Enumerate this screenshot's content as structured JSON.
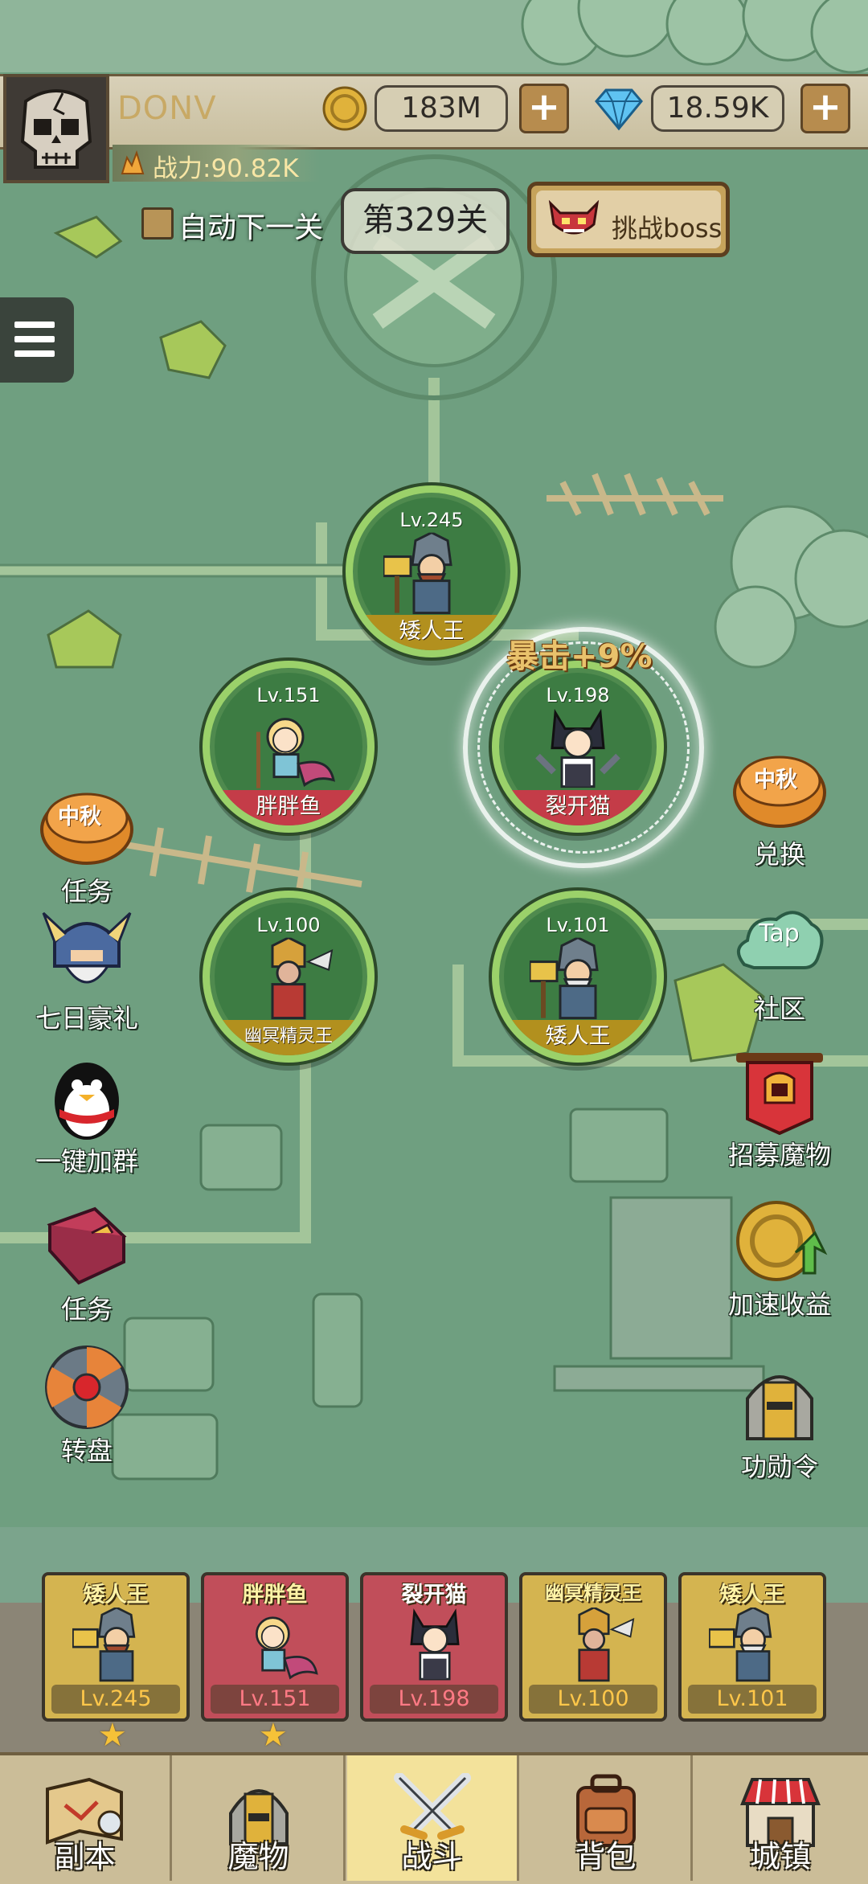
{
  "player": {
    "name": "DONV",
    "power": "战力:90.82K"
  },
  "currency": {
    "gold": "183M",
    "gems": "18.59K",
    "plus": "+"
  },
  "stage": {
    "auto_next_label": "自动下一关",
    "stage_label": "第329关",
    "boss_button_label": "挑战boss"
  },
  "battle_units": [
    {
      "level": "Lv.245",
      "name": "矮人王",
      "style": "gold"
    },
    {
      "level": "Lv.151",
      "name": "胖胖鱼",
      "style": "red"
    },
    {
      "level": "Lv.198",
      "name": "裂开猫",
      "style": "red"
    },
    {
      "level": "Lv.100",
      "name": "幽冥精灵王",
      "style": "gold"
    },
    {
      "level": "Lv.101",
      "name": "矮人王",
      "style": "gold"
    }
  ],
  "crit_buff": "暴击+9%",
  "left_icons": {
    "task_event": "任务",
    "seven_day": "七日豪礼",
    "join_group": "一键加群",
    "tasks": "任务",
    "wheel": "转盘",
    "moon_badge": "中秋"
  },
  "right_icons": {
    "exchange": "兑换",
    "community": "社区",
    "community_badge": "Tap",
    "recruit": "招募魔物",
    "speed_income": "加速收益",
    "merit_pass": "功勋令",
    "moon_badge": "中秋"
  },
  "team": [
    {
      "name": "矮人王",
      "level": "Lv.245",
      "style": "gold",
      "starred": true
    },
    {
      "name": "胖胖鱼",
      "level": "Lv.151",
      "style": "red",
      "starred": true
    },
    {
      "name": "裂开猫",
      "level": "Lv.198",
      "style": "red",
      "starred": false
    },
    {
      "name": "幽冥精灵王",
      "level": "Lv.100",
      "style": "gold",
      "starred": false
    },
    {
      "name": "矮人王",
      "level": "Lv.101",
      "style": "gold",
      "starred": false
    }
  ],
  "star_glyph": "★",
  "nav": {
    "dungeon": "副本",
    "monsters": "魔物",
    "battle": "战斗",
    "bag": "背包",
    "town": "城镇",
    "active": "battle"
  },
  "colors": {
    "map_green": "#6f9f80",
    "ring_green": "#9bd16a",
    "gold_banner": "#b2901e",
    "red_banner": "#c43c48",
    "active_tab": "#f3e29b"
  }
}
